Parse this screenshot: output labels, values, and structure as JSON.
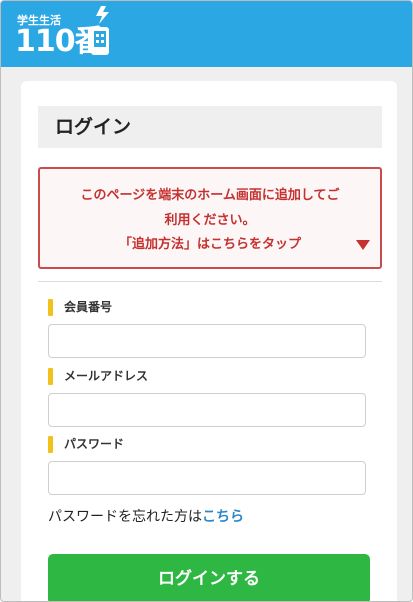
{
  "header": {
    "logo_top": "学生生活",
    "logo_main": "110番",
    "color": "#2ba8e4"
  },
  "login": {
    "title": "ログイン"
  },
  "notice": {
    "line1": "このページを端末のホーム画面に追加してご",
    "line2": "利用ください。",
    "line3": "「追加方法」はこちらをタップ",
    "color": "#c4312f"
  },
  "form": {
    "member_label": "会員番号",
    "member_value": "",
    "email_label": "メールアドレス",
    "email_value": "",
    "password_label": "パスワード",
    "password_value": ""
  },
  "forgot": {
    "text": "パスワードを忘れた方は",
    "link": "こちら"
  },
  "login_button": {
    "label": "ログインする",
    "color": "#2eb843"
  }
}
